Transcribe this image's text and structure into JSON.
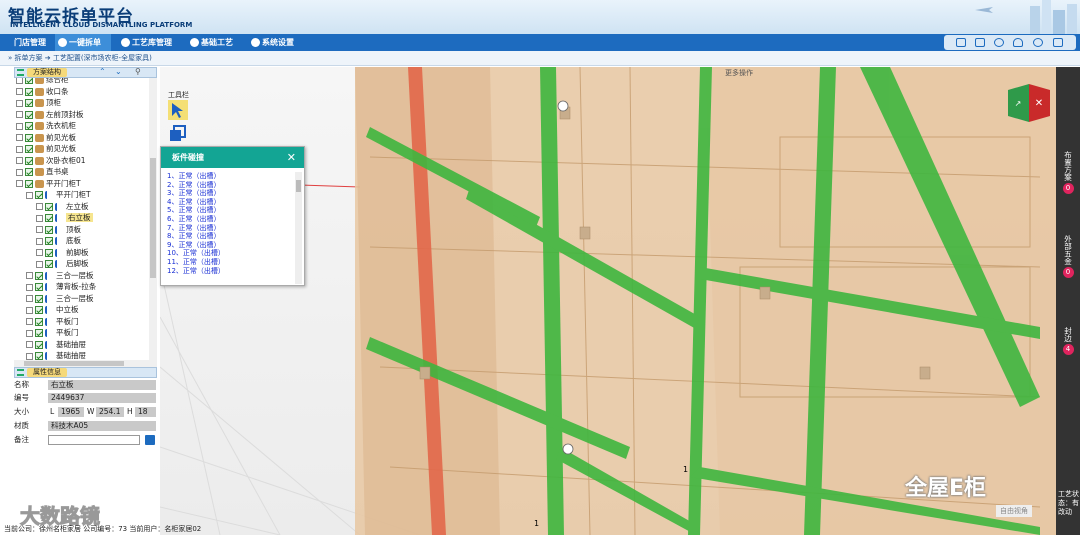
{
  "app": {
    "title_cn": "智能云拆单平台",
    "title_en": "INTELLIGENT CLOUD DISMANTLING PLATFORM"
  },
  "nav": {
    "items": [
      {
        "label": "门店管理"
      },
      {
        "label": "一键拆单",
        "active": true
      },
      {
        "label": "工艺库管理"
      },
      {
        "label": "基础工艺"
      },
      {
        "label": "系统设置"
      }
    ],
    "tool_icons": [
      "image-icon",
      "document-icon",
      "chat-icon",
      "user-icon",
      "gear-icon",
      "exit-icon"
    ]
  },
  "breadcrumb": "拆单方案 ➔ 工艺配置(深市场农柜-全屋家具)",
  "tree": {
    "title": "方案结构",
    "items": [
      {
        "label": "综合柜",
        "indent": 0,
        "icon": "cabinet"
      },
      {
        "label": "收口条",
        "indent": 0,
        "icon": "cabinet"
      },
      {
        "label": "顶柜",
        "indent": 0,
        "icon": "cabinet"
      },
      {
        "label": "左前顶封板",
        "indent": 0,
        "icon": "cabinet"
      },
      {
        "label": "洗衣机柜",
        "indent": 0,
        "icon": "cabinet"
      },
      {
        "label": "前见光板",
        "indent": 0,
        "icon": "cabinet"
      },
      {
        "label": "前见光板",
        "indent": 0,
        "icon": "cabinet"
      },
      {
        "label": "次卧衣柜01",
        "indent": 0,
        "icon": "cabinet"
      },
      {
        "label": "直书桌",
        "indent": 0,
        "icon": "cabinet"
      },
      {
        "label": "平开门柜T",
        "indent": 0,
        "icon": "cabinet"
      },
      {
        "label": "平开门柜T",
        "indent": 1,
        "icon": "part"
      },
      {
        "label": "左立板",
        "indent": 2,
        "icon": "part"
      },
      {
        "label": "右立板",
        "indent": 2,
        "icon": "part",
        "selected": true
      },
      {
        "label": "顶板",
        "indent": 2,
        "icon": "part"
      },
      {
        "label": "底板",
        "indent": 2,
        "icon": "part"
      },
      {
        "label": "前脚板",
        "indent": 2,
        "icon": "part"
      },
      {
        "label": "后脚板",
        "indent": 2,
        "icon": "part"
      },
      {
        "label": "三合一层板",
        "indent": 1,
        "icon": "part"
      },
      {
        "label": "薄背板-拉条",
        "indent": 1,
        "icon": "part"
      },
      {
        "label": "三合一层板",
        "indent": 1,
        "icon": "part"
      },
      {
        "label": "中立板",
        "indent": 1,
        "icon": "part"
      },
      {
        "label": "平板门",
        "indent": 1,
        "icon": "part"
      },
      {
        "label": "平板门",
        "indent": 1,
        "icon": "part"
      },
      {
        "label": "基础抽屉",
        "indent": 1,
        "icon": "part"
      },
      {
        "label": "基础抽屉",
        "indent": 1,
        "icon": "part"
      }
    ]
  },
  "props": {
    "title": "属性信息",
    "name_label": "名称",
    "name_value": "右立板",
    "code_label": "编号",
    "code_value": "2449637",
    "size_label": "大小",
    "L_label": "L",
    "L_value": "1965",
    "W_label": "W",
    "W_value": "254.1",
    "H_label": "H",
    "H_value": "18",
    "material_label": "材质",
    "material_value": "科技木A05",
    "note_label": "备注",
    "note_value": ""
  },
  "toolbox": {
    "label": "工具栏"
  },
  "dialog": {
    "title": "板件碰撞",
    "items": [
      "1、正常（出槽）",
      "2、正常（出槽）",
      "3、正常（出槽）",
      "4、正常（出槽）",
      "5、正常（出槽）",
      "6、正常（出槽）",
      "7、正常（出槽）",
      "8、正常（出槽）",
      "9、正常（出槽）",
      "10、正常（出槽）",
      "11、正常（出槽）",
      "12、正常（出槽）"
    ]
  },
  "viewport": {
    "more_label": "更多操作",
    "perspective_label": "自由视角",
    "marker_1": "1",
    "marker_2": "1"
  },
  "right_panel": {
    "tabs": [
      {
        "label": "布置方案",
        "count": "0"
      },
      {
        "label": "外部五金",
        "count": "0"
      },
      {
        "label": "封边",
        "count": "4"
      }
    ],
    "craft_status": "工艺状态：有改动"
  },
  "watermarks": {
    "left": "大数路镜",
    "right": "全屋E柜"
  },
  "status": {
    "text": "当前公司：徐州名柜家居   公司编号：73   当前用户：名柜家居02"
  },
  "colors": {
    "nav_bg": "#1d6bbf",
    "dialog_header": "#13a594",
    "board": "#e8c7a1",
    "connector": "#3fb63f",
    "highlight_board": "#e2674a"
  }
}
